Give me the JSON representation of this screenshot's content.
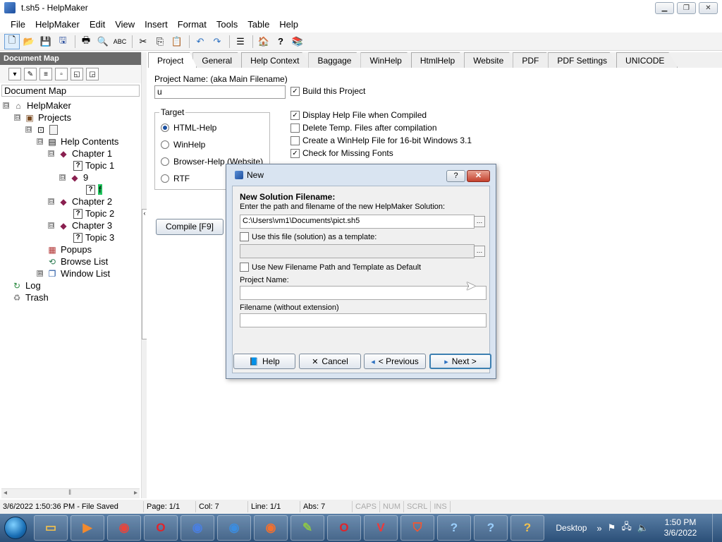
{
  "window": {
    "title": "t.sh5 - HelpMaker",
    "min": "▁",
    "max": "❐",
    "close": "✕"
  },
  "menu": [
    "File",
    "HelpMaker",
    "Edit",
    "View",
    "Insert",
    "Format",
    "Tools",
    "Table",
    "Help"
  ],
  "toolbar_icons": [
    "new-icon",
    "open-icon",
    "save-icon",
    "save-all-icon",
    "print-icon",
    "print-preview-icon",
    "spellcheck-icon",
    "cut-icon",
    "copy-icon",
    "paste-icon",
    "undo-icon",
    "redo-icon",
    "properties-icon",
    "compile-icon",
    "help-icon",
    "book-icon"
  ],
  "left_panel": {
    "header": "Document Map",
    "box_label": "Document Map",
    "tree": [
      {
        "label": "HelpMaker",
        "expander": "⊟",
        "icon": "home"
      },
      {
        "label": "Projects",
        "expander": "⊟",
        "icon": "projects"
      },
      {
        "label": "",
        "expander": "⊟",
        "icon": "project"
      },
      {
        "label": "Help Contents",
        "expander": "⊟",
        "icon": "contents"
      },
      {
        "label": "Chapter 1",
        "expander": "⊟",
        "icon": "book"
      },
      {
        "label": "Topic 1",
        "expander": "",
        "icon": "page"
      },
      {
        "label": "9",
        "expander": "⊟",
        "icon": "book"
      },
      {
        "label": "f",
        "expander": "",
        "icon": "page",
        "highlight": true
      },
      {
        "label": "Chapter 2",
        "expander": "⊟",
        "icon": "book"
      },
      {
        "label": "Topic 2",
        "expander": "",
        "icon": "page"
      },
      {
        "label": "Chapter 3",
        "expander": "⊟",
        "icon": "book"
      },
      {
        "label": "Topic 3",
        "expander": "",
        "icon": "page"
      },
      {
        "label": "Popups",
        "expander": "",
        "icon": "popups"
      },
      {
        "label": "Browse List",
        "expander": "",
        "icon": "browse"
      },
      {
        "label": "Window List",
        "expander": "⊞",
        "icon": "windows"
      },
      {
        "label": "Log",
        "expander": "",
        "icon": "log"
      },
      {
        "label": "Trash",
        "expander": "",
        "icon": "trash"
      }
    ]
  },
  "tabs": [
    "Project",
    "General",
    "Help Context",
    "Baggage",
    "WinHelp",
    "HtmlHelp",
    "Website",
    "PDF",
    "PDF Settings",
    "UNICODE"
  ],
  "project": {
    "name_label": "Project Name: (aka Main Filename)",
    "name_value": "u",
    "build_label": "Build this Project",
    "target_label": "Target",
    "targets": [
      "HTML-Help",
      "WinHelp",
      "Browser-Help (Website)",
      "RTF"
    ],
    "options": [
      {
        "label": "Display Help File when Compiled",
        "checked": true
      },
      {
        "label": "Delete Temp. Files after compilation",
        "checked": false
      },
      {
        "label": "Create a WinHelp File for 16-bit Windows 3.1",
        "checked": false
      },
      {
        "label": "Check for Missing Fonts",
        "checked": true
      }
    ],
    "compile_label": "Compile [F9]"
  },
  "dialog": {
    "title": "New",
    "heading": "New Solution Filename:",
    "instruction": "Enter the path and filename of the new HelpMaker Solution:",
    "path_value": "C:\\Users\\vm1\\Documents\\pict.sh5",
    "template_label": "Use this file (solution) as a template:",
    "default_label": "Use New Filename Path and Template as Default",
    "project_name_label": "Project Name:",
    "filename_label": "Filename (without extension)",
    "help_btn": "Help",
    "cancel_btn": "Cancel",
    "previous_btn": "< Previous",
    "next_btn": "Next >"
  },
  "status": {
    "saved": "3/6/2022 1:50:36 PM - File Saved",
    "page": "Page: 1/1",
    "col": "Col: 7",
    "line": "Line: 1/1",
    "abs": "Abs: 7",
    "caps": "CAPS",
    "num": "NUM",
    "scrl": "SCRL",
    "ins": "INS"
  },
  "taskbar": {
    "apps": [
      "explorer",
      "media-player",
      "chrome",
      "opera",
      "firefox-dev",
      "firefox-nightly",
      "firefox",
      "app-tool",
      "opera-gx",
      "vivaldi",
      "brave",
      "help-viewer",
      "help-viewer-2",
      "helpmaker"
    ],
    "desktop": "Desktop",
    "time": "1:50 PM",
    "date": "3/6/2022"
  }
}
